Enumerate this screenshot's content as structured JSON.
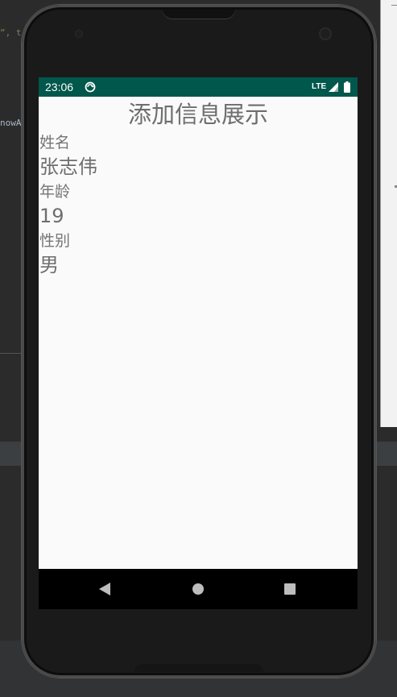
{
  "ide": {
    "code_line_1": "”, t",
    "code_line_2": "nowA"
  },
  "status_bar": {
    "time": "23:06",
    "network": "LTE",
    "background_color": "#00574b",
    "sync_icon": "sync-icon",
    "signal_icon": "signal-icon",
    "battery_icon": "battery-icon"
  },
  "screen": {
    "title": "添加信息展示",
    "fields": {
      "name_label": "姓名",
      "name_value": "张志伟",
      "age_label": "年龄",
      "age_value": "19",
      "gender_label": "性别",
      "gender_value": "男"
    }
  },
  "nav_bar": {
    "back_icon": "back-triangle-icon",
    "home_icon": "home-circle-icon",
    "recents_icon": "recents-square-icon"
  }
}
